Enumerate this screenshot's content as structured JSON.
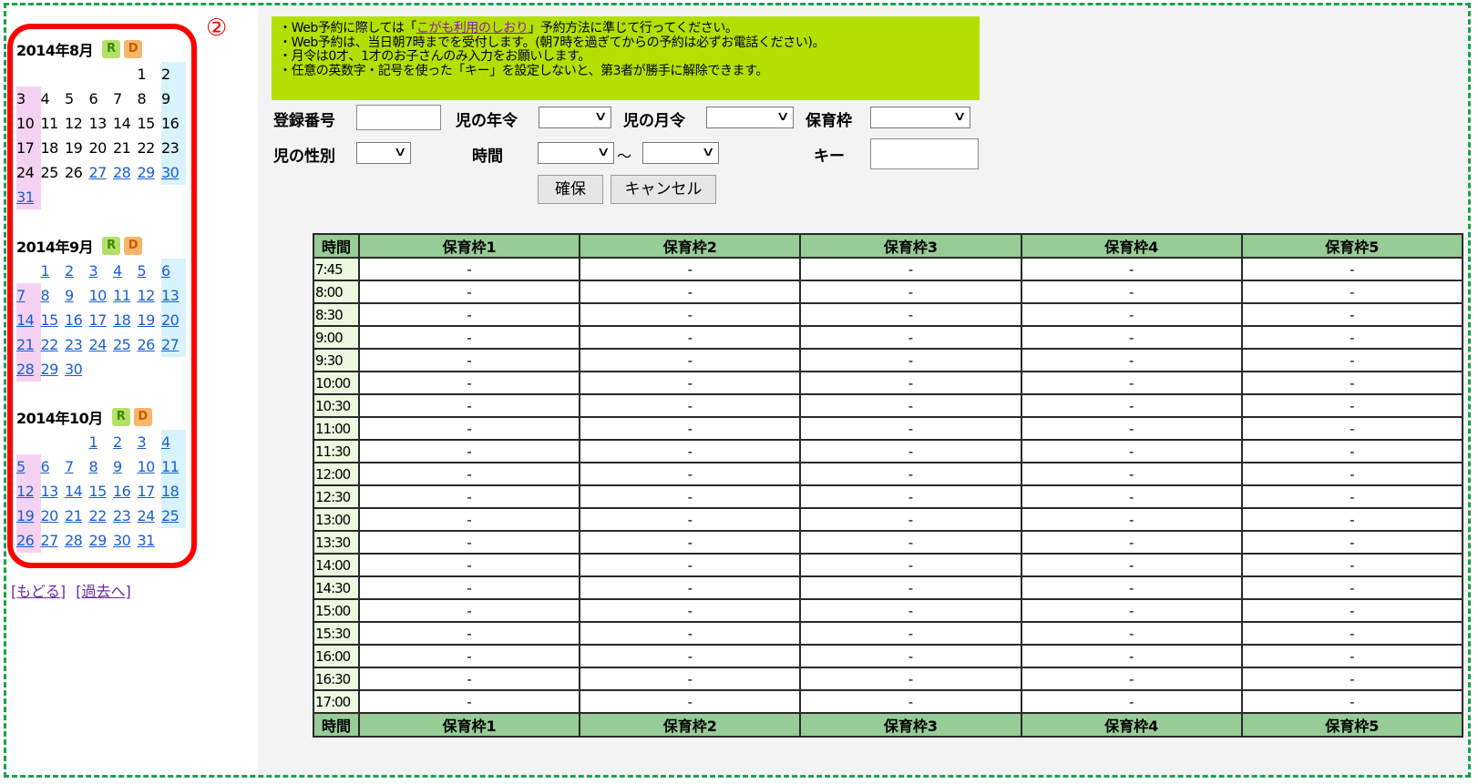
{
  "marker": "②",
  "calendars": [
    {
      "title": "2014年8月",
      "badge_r": "R",
      "badge_d": "D",
      "days": [
        [
          "",
          "",
          "",
          "",
          "",
          "1",
          "2"
        ],
        [
          "3",
          "4",
          "5",
          "6",
          "7",
          "8",
          "9"
        ],
        [
          "10",
          "11",
          "12",
          "13",
          "14",
          "15",
          "16"
        ],
        [
          "17",
          "18",
          "19",
          "20",
          "21",
          "22",
          "23"
        ],
        [
          "24",
          "25",
          "26",
          "27",
          "28",
          "29",
          "30"
        ],
        [
          "31",
          "",
          "",
          "",
          "",
          "",
          ""
        ]
      ]
    },
    {
      "title": "2014年9月",
      "badge_r": "R",
      "badge_d": "D",
      "days": [
        [
          "",
          "1",
          "2",
          "3",
          "4",
          "5",
          "6"
        ],
        [
          "7",
          "8",
          "9",
          "10",
          "11",
          "12",
          "13"
        ],
        [
          "14",
          "15",
          "16",
          "17",
          "18",
          "19",
          "20"
        ],
        [
          "21",
          "22",
          "23",
          "24",
          "25",
          "26",
          "27"
        ],
        [
          "28",
          "29",
          "30",
          "",
          "",
          "",
          ""
        ]
      ]
    },
    {
      "title": "2014年10月",
      "badge_r": "R",
      "badge_d": "D",
      "days": [
        [
          "",
          "",
          "",
          "1",
          "2",
          "3",
          "4"
        ],
        [
          "5",
          "6",
          "7",
          "8",
          "9",
          "10",
          "11"
        ],
        [
          "12",
          "13",
          "14",
          "15",
          "16",
          "17",
          "18"
        ],
        [
          "19",
          "20",
          "21",
          "22",
          "23",
          "24",
          "25"
        ],
        [
          "26",
          "27",
          "28",
          "29",
          "30",
          "31",
          ""
        ]
      ]
    }
  ],
  "bottom_links": {
    "back": "[もどる]",
    "past": "[過去へ]"
  },
  "notice": {
    "line1_pre": "・Web予約に際しては「",
    "line1_link": "こがも利用のしおり",
    "line1_post": "」予約方法に準じて行ってください。",
    "line2": "・Web予約は、当日朝7時までを受付します。(朝7時を過ぎてからの予約は必ずお電話ください)。",
    "line3": "・月令は0才、1才のお子さんのみ入力をお願いします。",
    "line4": "・任意の英数字・記号を使った「キー」を設定しないと、第3者が勝手に解除できます。"
  },
  "form": {
    "reg_no_label": "登録番号",
    "age_label": "児の年令",
    "month_label": "児の月令",
    "slot_label": "保育枠",
    "gender_label": "児の性別",
    "time_label": "時間",
    "tilde": "～",
    "key_label": "キー",
    "confirm_button": "確保",
    "cancel_button": "キャンセル"
  },
  "table": {
    "time_header": "時間",
    "slot_headers": [
      "保育枠1",
      "保育枠2",
      "保育枠3",
      "保育枠4",
      "保育枠5"
    ],
    "empty_mark": "-",
    "times": [
      "7:45",
      "8:00",
      "8:30",
      "9:00",
      "9:30",
      "10:00",
      "10:30",
      "11:00",
      "11:30",
      "12:00",
      "12:30",
      "13:00",
      "13:30",
      "14:00",
      "14:30",
      "15:00",
      "15:30",
      "16:00",
      "16:30",
      "17:00"
    ]
  },
  "colors": {
    "frame": "#1aa24a",
    "notice_bg": "#b3e000",
    "header_bg": "#96cc96",
    "highlight": "#ff0000",
    "link": "#1a5fd0"
  }
}
